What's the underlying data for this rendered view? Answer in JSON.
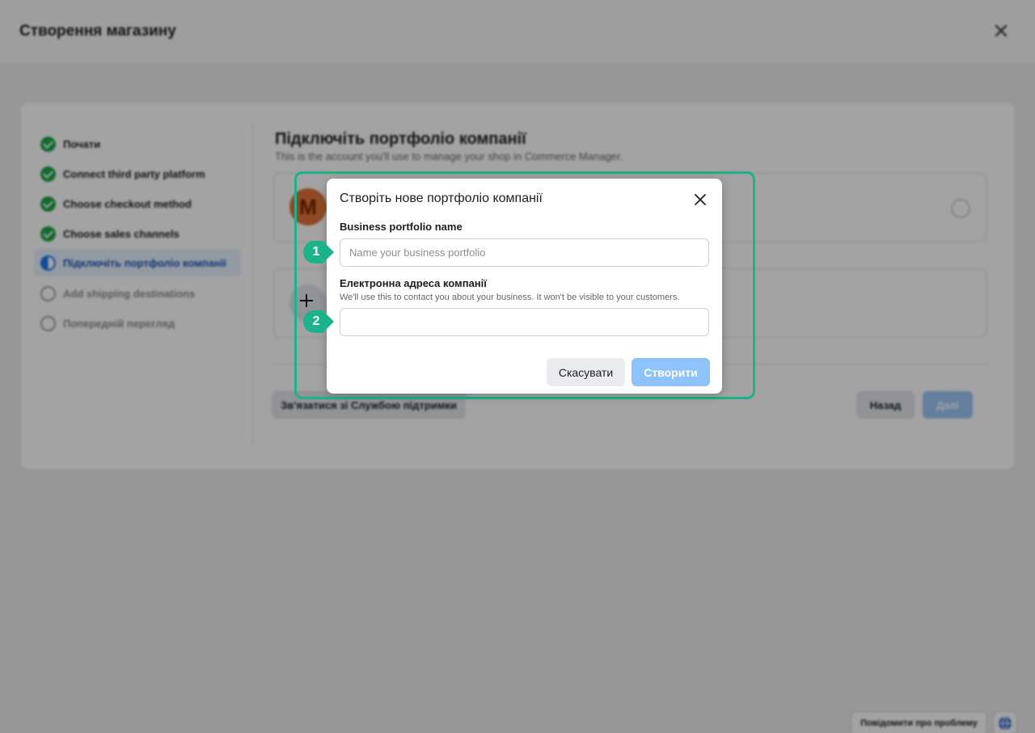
{
  "header": {
    "title": "Створення магазину"
  },
  "steps": [
    {
      "label": "Почати",
      "status": "done"
    },
    {
      "label": "Connect third party platform",
      "status": "done"
    },
    {
      "label": "Choose checkout method",
      "status": "done"
    },
    {
      "label": "Choose sales channels",
      "status": "done"
    },
    {
      "label": "Підключіть портфоліо компанії",
      "status": "current"
    },
    {
      "label": "Add shipping destinations",
      "status": "todo"
    },
    {
      "label": "Попередній перегляд",
      "status": "todo"
    }
  ],
  "main": {
    "title": "Підключіть портфоліо компанії",
    "subtitle": "This is the account you'll use to manage your shop in Commerce Manager.",
    "portfolio_avatar_letter": "M"
  },
  "footer": {
    "support_label": "Зв'язатися зі Службою підтримки",
    "back_label": "Назад",
    "next_label": "Далі",
    "report_label": "Повідомити про проблему"
  },
  "dialog": {
    "title": "Створіть нове портфоліо компанії",
    "name_label": "Business portfolio name",
    "name_placeholder": "Name your business portfolio",
    "name_value": "",
    "email_label": "Електронна адреса компанії",
    "email_help": "We'll use this to contact you about your business. It won't be visible to your customers.",
    "email_value": "",
    "cancel_label": "Скасувати",
    "create_label": "Створити"
  },
  "markers": [
    "1",
    "2"
  ],
  "colors": {
    "accent": "#1bb389",
    "primary": "#1877f2",
    "done": "#1fa64a"
  }
}
